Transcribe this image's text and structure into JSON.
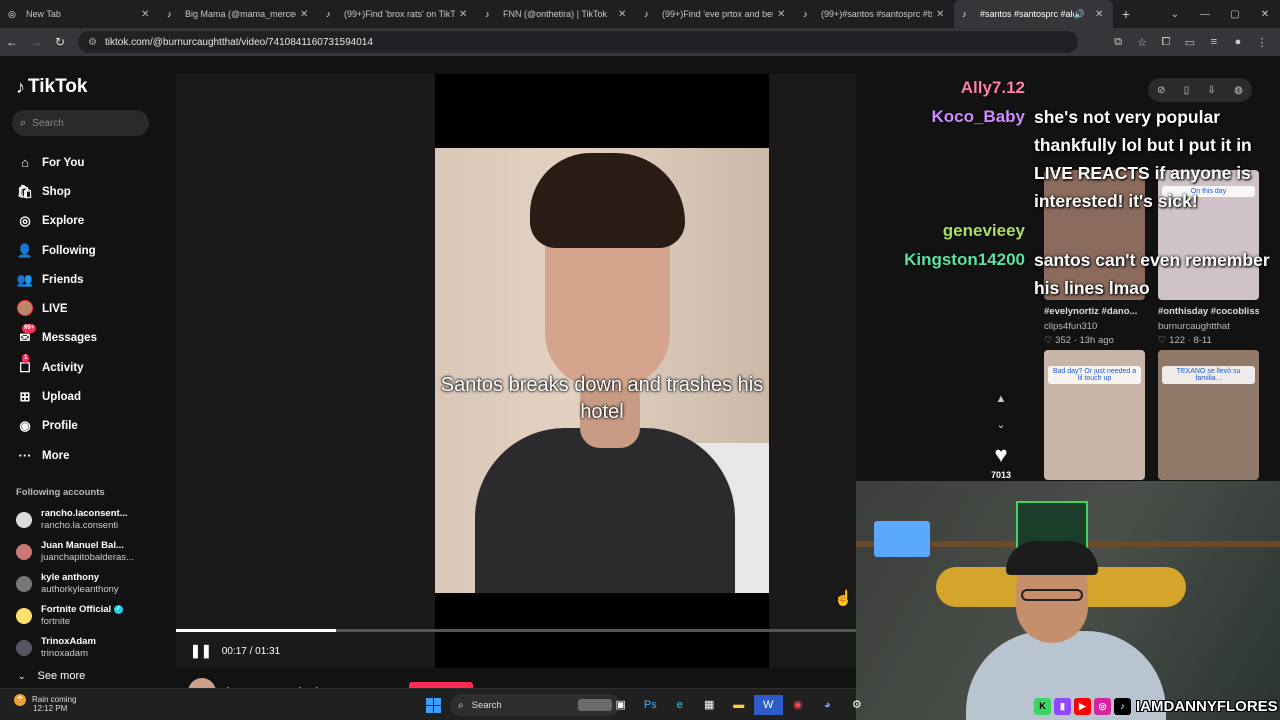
{
  "browser": {
    "tabs": [
      {
        "title": "New Tab",
        "active": false
      },
      {
        "title": "Big Mama (@mama_mercedes",
        "active": false
      },
      {
        "title": "(99+)Find 'brox rats' on TikTok",
        "active": false
      },
      {
        "title": "FNN (@onthetira) | TikTok",
        "active": false
      },
      {
        "title": "(99+)Find 'eve prtox and benjy",
        "active": false
      },
      {
        "title": "(99+)#santos #santosprc #bri",
        "active": false
      },
      {
        "title": "#santos #santosprc #alogo",
        "active": true
      }
    ],
    "url": "tiktok.com/@burnurcaughtthat/video/7410841160731594014"
  },
  "sidebar": {
    "logo": "TikTok",
    "search_placeholder": "Search",
    "nav": [
      {
        "label": "For You",
        "icon": "home-icon",
        "glyph": "⌂"
      },
      {
        "label": "Shop",
        "icon": "shop-bag-icon",
        "glyph": "🛍"
      },
      {
        "label": "Explore",
        "icon": "compass-icon",
        "glyph": "◎"
      },
      {
        "label": "Following",
        "icon": "following-icon",
        "glyph": "👤"
      },
      {
        "label": "Friends",
        "icon": "friends-icon",
        "glyph": "👥"
      },
      {
        "label": "LIVE",
        "icon": "live-icon",
        "glyph": ""
      },
      {
        "label": "Messages",
        "icon": "messages-icon",
        "glyph": "✉",
        "badge": "99+"
      },
      {
        "label": "Activity",
        "icon": "activity-icon",
        "glyph": "☐",
        "badge": "1"
      },
      {
        "label": "Upload",
        "icon": "upload-icon",
        "glyph": "⊞"
      },
      {
        "label": "Profile",
        "icon": "profile-icon",
        "glyph": "◉"
      },
      {
        "label": "More",
        "icon": "more-icon",
        "glyph": "···"
      }
    ],
    "following_header": "Following accounts",
    "following": [
      {
        "name": "rancho.laconsent...",
        "handle": "rancho.la.consenti",
        "color": "#ddd"
      },
      {
        "name": "Juan Manuel Bal...",
        "handle": "juanchapitobalderas...",
        "color": "#c77"
      },
      {
        "name": "kyle anthony",
        "handle": "authorkyleanthony",
        "color": "#777"
      },
      {
        "name": "Fortnite Official",
        "handle": "fortnite",
        "color": "#ffe066",
        "verified": true
      },
      {
        "name": "TrinoxAdam",
        "handle": "trinoxadam",
        "color": "#556"
      }
    ],
    "see_more": "See more"
  },
  "video": {
    "caption": "Santos breaks down and trashes his hotel",
    "time": "00:17 / 01:31",
    "progress": 0.235,
    "author": "burnurcaughtthat",
    "likes": "7013"
  },
  "chat": [
    {
      "name": "Ally7.12",
      "color": "#ff7fa8",
      "msg": "she's not very popular thankfully lol but I put it in LIVE REACTS if anyone is interested! it's sick!"
    },
    {
      "name": "Koco_Baby",
      "color": "#d08cff",
      "msg": ""
    },
    {
      "name": "genevieey",
      "color": "#a8e060",
      "msg": ""
    },
    {
      "name": "Kingston14200",
      "color": "#5fe0a0",
      "msg": "santos can't even remember his lines lmao"
    }
  ],
  "recommended": [
    {
      "title": "#evelynortiz #dano...",
      "author": "clips4fun310",
      "stats": "♡ 352 · 13h ago",
      "bg": "#8a6b5d"
    },
    {
      "title": "#onthisday #cocobliss...",
      "author": "burnurcaughtthat",
      "stats": "♡ 122 · 8-11",
      "bg": "#cfc2c8",
      "overlay": "On this day"
    },
    {
      "title": "",
      "author": "",
      "stats": "",
      "bg": "#c9b4a8",
      "overlay": "Bad day? Or just needed a lil touch up"
    },
    {
      "title": "",
      "author": "",
      "stats": "",
      "bg": "#8f7a6a",
      "overlay": "TEXANO se llevó su familia..."
    }
  ],
  "stream": {
    "handle": "IAMDANNYFLORES"
  },
  "taskbar": {
    "weather": "Rain coming",
    "time": "12:12 PM",
    "search": "Search"
  }
}
